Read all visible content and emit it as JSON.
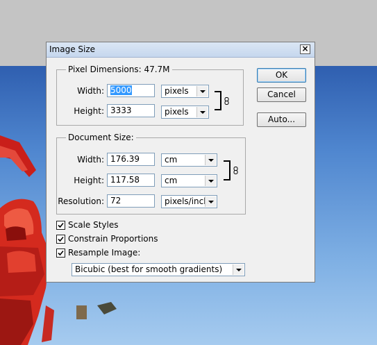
{
  "dialog": {
    "title": "Image Size",
    "close_glyph": "×"
  },
  "pixel_dimensions": {
    "legend": "Pixel Dimensions:  47.7M",
    "width_label": "Width:",
    "width_value": "5000",
    "width_unit": "pixels",
    "height_label": "Height:",
    "height_value": "3333",
    "height_unit": "pixels"
  },
  "document_size": {
    "legend": "Document Size:",
    "width_label": "Width:",
    "width_value": "176.39",
    "width_unit": "cm",
    "height_label": "Height:",
    "height_value": "117.58",
    "height_unit": "cm",
    "resolution_label": "Resolution:",
    "resolution_value": "72",
    "resolution_unit": "pixels/inch"
  },
  "buttons": {
    "ok": "OK",
    "reset": "Cancel",
    "auto": "Auto..."
  },
  "options": {
    "scale_styles": {
      "label": "Scale Styles",
      "checked": true
    },
    "constrain_proportions": {
      "label": "Constrain Proportions",
      "checked": true
    },
    "resample_image": {
      "label": "Resample Image:",
      "checked": true
    },
    "resample_method": "Bicubic (best for smooth gradients)"
  },
  "icons": {
    "link": "chain-link-icon",
    "dropdown": "chevron-down-icon",
    "check": "checkmark-icon"
  },
  "colors": {
    "titlebar": "#c6d7ee",
    "dialog_bg": "#f0f0f0",
    "selection": "#3399ff",
    "desktop_gray": "#c4c4c4",
    "sky_blue": "#4f86cf",
    "figure_red": "#d42a1e"
  }
}
